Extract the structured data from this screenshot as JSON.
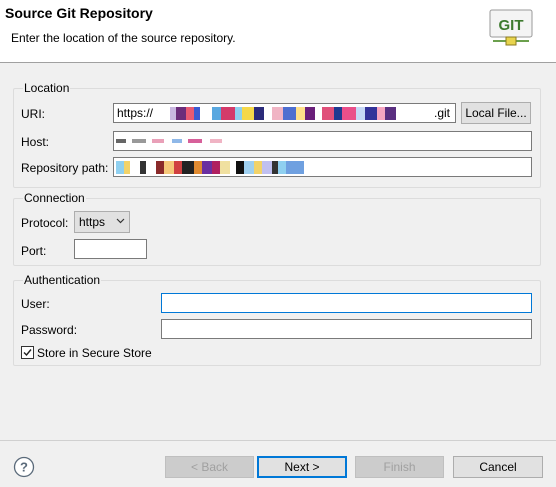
{
  "header": {
    "title": "Source Git Repository",
    "description": "Enter the location of the source repository.",
    "logo_text": "GIT"
  },
  "location": {
    "group_title": "Location",
    "uri_label": "URI:",
    "uri_prefix": "https://",
    "uri_suffix": ".git",
    "local_file_label": "Local File...",
    "host_label": "Host:",
    "repo_path_label": "Repository path:"
  },
  "connection": {
    "group_title": "Connection",
    "protocol_label": "Protocol:",
    "protocol_value": "https",
    "port_label": "Port:",
    "port_value": ""
  },
  "authentication": {
    "group_title": "Authentication",
    "user_label": "User:",
    "user_value": "",
    "password_label": "Password:",
    "password_value": "",
    "store_label": "Store in Secure Store",
    "store_checked": true
  },
  "footer": {
    "back_label": "< Back",
    "next_label": "Next >",
    "finish_label": "Finish",
    "cancel_label": "Cancel"
  },
  "colors": {
    "accent": "#0078d7",
    "header_bg": "#ffffff",
    "dialog_bg": "#f0f0f0",
    "logo_green": "#4a8a3a"
  },
  "icons": {
    "logo": "git-logo-icon",
    "help": "help-icon",
    "dropdown": "chevron-down-icon",
    "check": "checkmark-icon"
  }
}
